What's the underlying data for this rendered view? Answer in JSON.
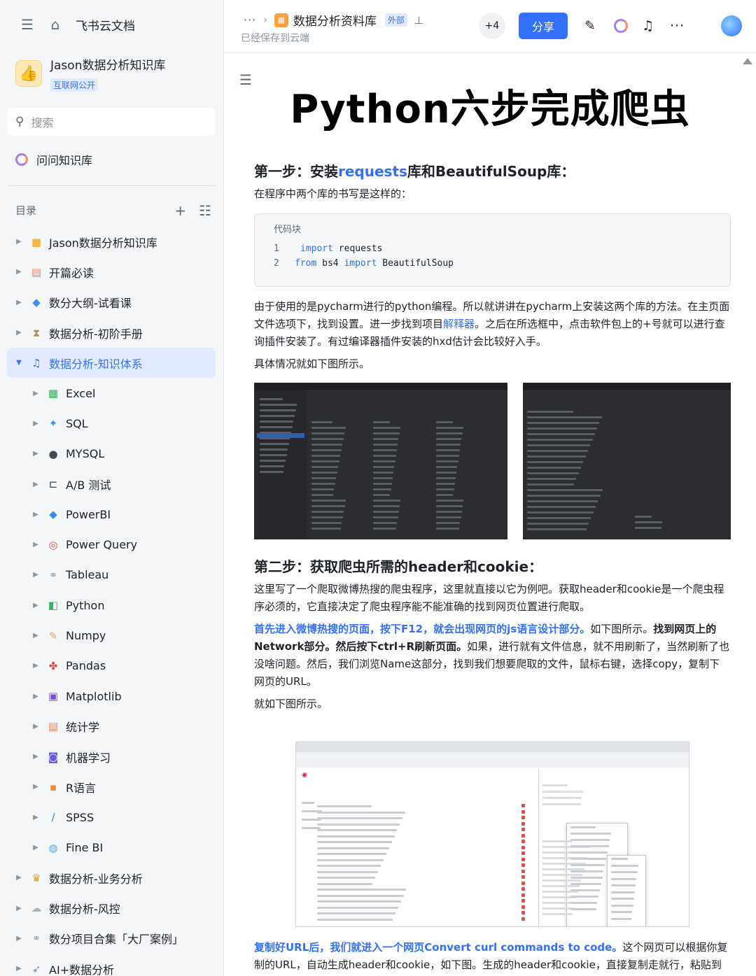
{
  "sidebar": {
    "top_menu_icon": "collapse-menu-icon",
    "top_home_icon": "home-icon",
    "app_name": "飞书云文档",
    "kb_name": "Jason数据分析知识库",
    "kb_badge": "互联网公开",
    "search_placeholder": "搜索",
    "ask_label": "问问知识库",
    "toc_label": "目录",
    "items": [
      {
        "label": "Jason数据分析知识库",
        "icon": "folder-icon",
        "glyph": "■",
        "color": "#f5b83d",
        "level": 0
      },
      {
        "label": "开篇必读",
        "icon": "book-icon",
        "glyph": "▤",
        "color": "#f07f5b",
        "level": 0
      },
      {
        "label": "数分大纲-试看课",
        "icon": "diamond-icon",
        "glyph": "◆",
        "color": "#3a8ef6",
        "level": 0
      },
      {
        "label": "数据分析-初阶手册",
        "icon": "hourglass-icon",
        "glyph": "⧗",
        "color": "#b08a5a",
        "level": 0
      },
      {
        "label": "数据分析-知识体系",
        "icon": "music-note-icon",
        "glyph": "♫",
        "color": "#3370ff",
        "level": 0,
        "active": true,
        "expanded": true
      },
      {
        "label": "Excel",
        "icon": "excel-icon",
        "glyph": "▦",
        "color": "#34a853",
        "level": 1
      },
      {
        "label": "SQL",
        "icon": "sql-icon",
        "glyph": "✦",
        "color": "#2f9be8",
        "level": 1
      },
      {
        "label": "MYSQL",
        "icon": "mysql-icon",
        "glyph": "●",
        "color": "#444a55",
        "level": 1
      },
      {
        "label": "A/B 测试",
        "icon": "ab-test-icon",
        "glyph": "⊏",
        "color": "#3b3f46",
        "level": 1
      },
      {
        "label": "PowerBI",
        "icon": "powerbi-icon",
        "glyph": "◆",
        "color": "#2f8ff0",
        "level": 1
      },
      {
        "label": "Power Query",
        "icon": "target-icon",
        "glyph": "◎",
        "color": "#e8473c",
        "level": 1
      },
      {
        "label": "Tableau",
        "icon": "tableau-icon",
        "glyph": "⚭",
        "color": "#9aa3ad",
        "level": 1
      },
      {
        "label": "Python",
        "icon": "python-icon",
        "glyph": "◧",
        "color": "#2fb36d",
        "level": 1
      },
      {
        "label": "Numpy",
        "icon": "pencil-icon",
        "glyph": "✎",
        "color": "#f0a43a",
        "level": 1
      },
      {
        "label": "Pandas",
        "icon": "pandas-icon",
        "glyph": "✤",
        "color": "#e8473c",
        "level": 1
      },
      {
        "label": "Matplotlib",
        "icon": "matplotlib-icon",
        "glyph": "▣",
        "color": "#7a4fd8",
        "level": 1
      },
      {
        "label": "统计学",
        "icon": "statistics-icon",
        "glyph": "▤",
        "color": "#f07f5b",
        "level": 1
      },
      {
        "label": "机器学习",
        "icon": "robot-icon",
        "glyph": "◙",
        "color": "#6a5be0",
        "level": 1
      },
      {
        "label": "R语言",
        "icon": "r-language-icon",
        "glyph": "▪",
        "color": "#f08a3a",
        "level": 1
      },
      {
        "label": "SPSS",
        "icon": "spss-icon",
        "glyph": "∕",
        "color": "#3a7bf0",
        "level": 1
      },
      {
        "label": "Fine BI",
        "icon": "globe-icon",
        "glyph": "◍",
        "color": "#4aa8f0",
        "level": 1
      },
      {
        "label": "数据分析-业务分析",
        "icon": "medal-icon",
        "glyph": "♛",
        "color": "#e0a020",
        "level": 0
      },
      {
        "label": "数据分析-风控",
        "icon": "cloud-icon",
        "glyph": "☁",
        "color": "#aab4c0",
        "level": 0
      },
      {
        "label": "数分项目合集「大厂案例」",
        "icon": "link-icon",
        "glyph": "⚭",
        "color": "#9aa3ad",
        "level": 0
      },
      {
        "label": "AI+数据分析",
        "icon": "rocket-icon",
        "glyph": "➶",
        "color": "#5a8ff0",
        "level": 0
      }
    ]
  },
  "header": {
    "more": "···",
    "doc_title": "数据分析资料库",
    "external_tag": "外部",
    "saved_status": "已经保存到云端",
    "collaborator_count": "+4",
    "share_label": "分享"
  },
  "doc": {
    "title": "Python六步完成爬虫",
    "step1_prefix": "第一步：安装",
    "step1_link": "requests",
    "step1_suffix": "库和BeautifulSoup库：",
    "step1_intro": "在程序中两个库的书写是这样的：",
    "code": {
      "label": "代码块",
      "lines": [
        {
          "no": "1",
          "kw": "import",
          "rest": " requests",
          "kw2": "",
          "rest2": ""
        },
        {
          "no": "2",
          "kw": "from",
          "rest": " bs4 ",
          "kw2": "import",
          "rest2": " BeautifulSoup"
        }
      ]
    },
    "para1_a": "由于使用的是pycharm进行的python编程。所以就讲讲在pycharm上安装这两个库的方法。在主页面文件选项下，找到设置。进一步找到项目",
    "para1_link": "解释器",
    "para1_b": "。之后在所选框中，点击软件包上的+号就可以进行查询插件安装了。有过编译器插件安装的hxd估计会比较好入手。",
    "para2": "具体情况就如下图所示。",
    "step2": "第二步：获取爬虫所需的header和cookie：",
    "para3": "这里写了一个爬取微博热搜的爬虫程序，这里就直接以它为例吧。获取header和cookie是一个爬虫程序必须的，它直接决定了爬虫程序能不能准确的找到网页位置进行爬取。",
    "para4_blue": "首先进入微博热搜的页面，按下F12，就会出现网页的js语言设计部分。",
    "para4_a": "如下图所示。",
    "para4_bold": "找到网页上的Network部分。然后按下ctrl+R刷新页面。",
    "para4_b": "如果，进行就有文件信息，就不用刷新了，当然刷新了也没啥问题。然后，我们浏览Name这部分，找到我们想要爬取的文件，鼠标右键，选择copy，复制下网页的URL。",
    "para5": "就如下图所示。",
    "para6_blue": "复制好URL后，我们就进入一个网页Convert curl commands to code。",
    "para6_a": "这个网页可以根据你复制的URL，自动生成header和cookie，如下图。生成的header和cookie，直接复制走就行，粘贴到程序"
  }
}
